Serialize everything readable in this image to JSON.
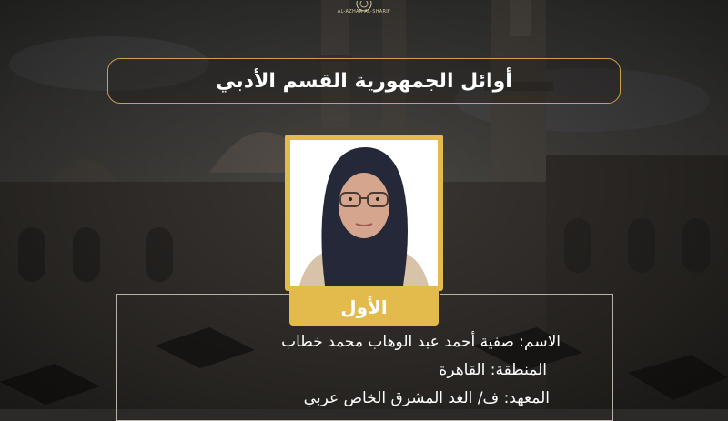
{
  "logo": {
    "caption": "AL-AZHAR AL-SHARIF"
  },
  "header": {
    "title": "أوائل الجمهورية القسم الأدبي"
  },
  "rank": {
    "label": "الأول"
  },
  "student": {
    "name_line": "الاسم: صفية أحمد عبد الوهاب محمد خطاب",
    "region_line": "المنطقة: القاهرة",
    "institute_line": "المعهد: ف/ الغد المشرق الخاص عربي"
  },
  "colors": {
    "accent_gold": "#e3bb4d",
    "title_border": "#c9a24a",
    "background": "#2b2a28",
    "text": "#ffffff"
  }
}
